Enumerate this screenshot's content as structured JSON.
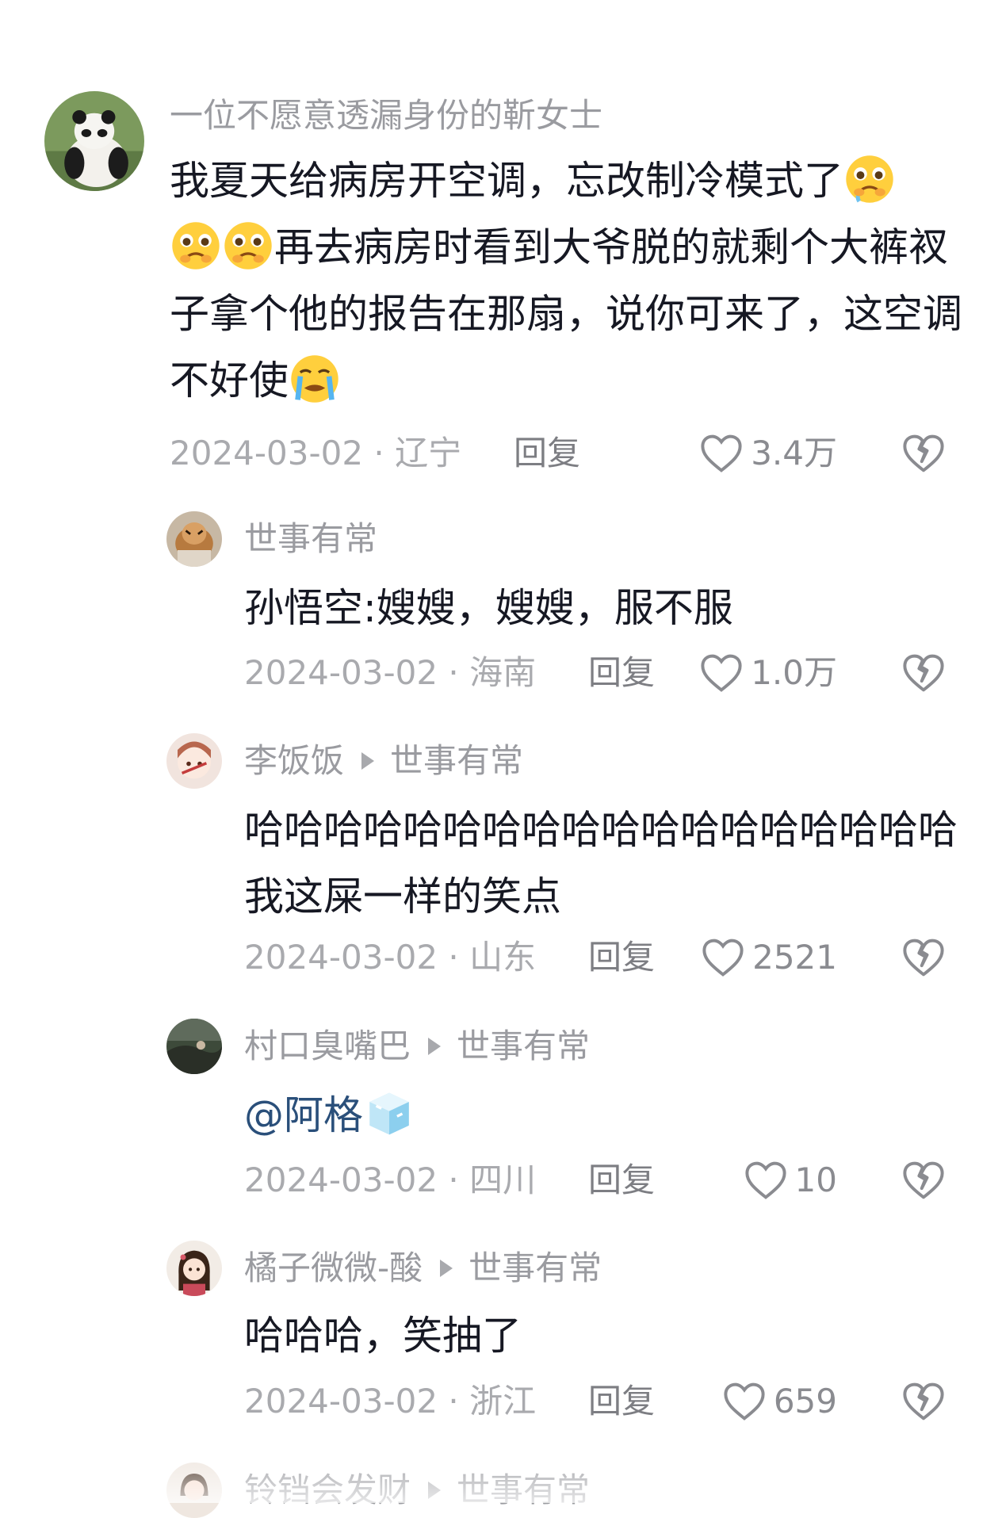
{
  "comments": [
    {
      "username": "一位不愿意透漏身份的靳女士",
      "text_parts": [
        "我夏天给病房开空调，忘改制冷模式了",
        "再去病房时看到大爷脱的就剩个大裤衩子拿个他的报告在那扇，说你可来了，这空调不好使"
      ],
      "date_location": "2024-03-02 · 辽宁",
      "reply_label": "回复",
      "likes": "3.4万",
      "avatar_icon": "panda-avatar"
    },
    {
      "username": "世事有常",
      "text": "孙悟空:嫂嫂，嫂嫂，服不服",
      "date_location": "2024-03-02 · 海南",
      "reply_label": "回复",
      "likes": "1.0万",
      "avatar_icon": "tiger-avatar"
    },
    {
      "username": "李饭饭",
      "reply_to": "世事有常",
      "text": "哈哈哈哈哈哈哈哈哈哈哈哈哈哈哈哈哈哈 我这屎一样的笑点",
      "date_location": "2024-03-02 · 山东",
      "reply_label": "回复",
      "likes": "2521",
      "avatar_icon": "cartoon-avatar"
    },
    {
      "username": "村口臭嘴巴",
      "reply_to": "世事有常",
      "text": "@阿格",
      "date_location": "2024-03-02 · 四川",
      "reply_label": "回复",
      "likes": "10",
      "avatar_icon": "landscape-avatar"
    },
    {
      "username": "橘子微微-酸",
      "reply_to": "世事有常",
      "text": "哈哈哈，笑抽了",
      "date_location": "2024-03-02 · 浙江",
      "reply_label": "回复",
      "likes": "659",
      "avatar_icon": "girl-avatar"
    },
    {
      "username": "铃铛会发财",
      "reply_to": "世事有常",
      "avatar_icon": "portrait-avatar"
    }
  ],
  "colors": {
    "username": "#9a9ba0",
    "text": "#161823",
    "meta": "#a9aaae",
    "mention": "#2a4f7a"
  }
}
